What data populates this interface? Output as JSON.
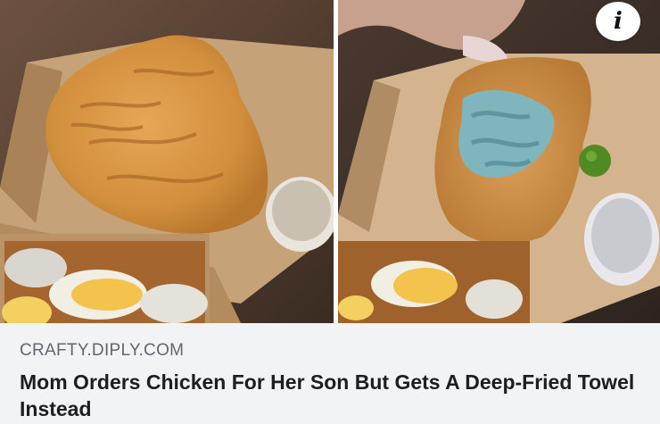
{
  "post": {
    "source": "CRAFTY.DIPLY.COM",
    "headline": "Mom Orders Chicken For Her Son But Gets A Deep-Fried Towel Instead",
    "info_icon_glyph": "i",
    "info_icon": "info-icon"
  },
  "colors": {
    "caption_bg": "#f2f3f5",
    "source_text": "#606770",
    "headline_text": "#1c1e21",
    "fried_crust": "#d0913f",
    "towel": "#7fb6bd"
  }
}
